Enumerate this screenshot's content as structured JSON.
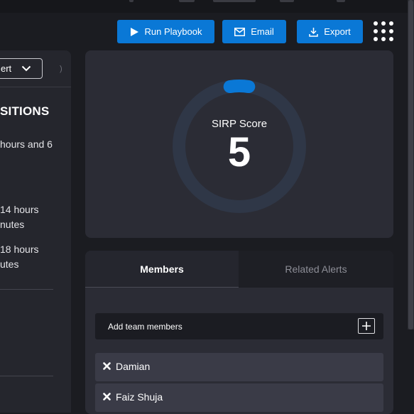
{
  "toolbar": {
    "run_playbook_label": "Run Playbook",
    "email_label": "Email",
    "export_label": "Export",
    "apps_icon": "grid-dots-icon"
  },
  "left_panel": {
    "select_value": "ert",
    "heading": "SITIONS",
    "lines": [
      "hours and 6",
      "14 hours",
      "nutes",
      "18 hours",
      "utes"
    ]
  },
  "sirp_score": {
    "label": "SIRP Score",
    "value": "5",
    "max": 100
  },
  "members_panel": {
    "tabs": [
      {
        "label": "Members",
        "active": true
      },
      {
        "label": "Related Alerts",
        "active": false
      }
    ],
    "add_label": "Add team members",
    "members": [
      {
        "name": "Damian"
      },
      {
        "name": "Faiz Shuja"
      }
    ]
  },
  "colors": {
    "accent": "#0a78d6",
    "background": "#1b1c21",
    "card": "#2b2c35",
    "ring_track": "#2f3747"
  }
}
